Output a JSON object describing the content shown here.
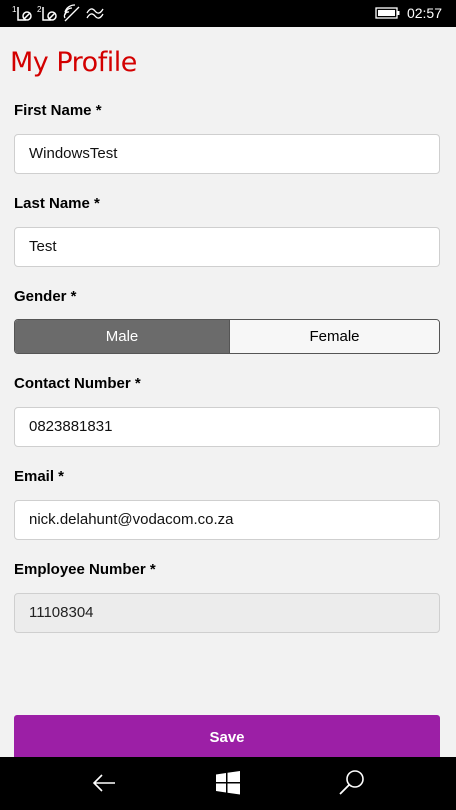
{
  "status_bar": {
    "time": "02:57",
    "sim1_label": "1",
    "sim2_label": "2"
  },
  "page": {
    "title": "My Profile"
  },
  "form": {
    "first_name": {
      "label": "First Name *",
      "value": "WindowsTest"
    },
    "last_name": {
      "label": "Last Name *",
      "value": "Test"
    },
    "gender": {
      "label": "Gender *",
      "options": [
        "Male",
        "Female"
      ],
      "selected": "Male"
    },
    "contact_number": {
      "label": "Contact Number *",
      "value": "0823881831"
    },
    "email": {
      "label": "Email *",
      "value": "nick.delahunt@vodacom.co.za"
    },
    "employee_number": {
      "label": "Employee Number *",
      "value": "11108304"
    }
  },
  "actions": {
    "save_label": "Save"
  },
  "nav": {
    "icons": [
      "back-arrow-icon",
      "windows-start-icon",
      "search-icon"
    ]
  },
  "colors": {
    "title_red": "#d30000",
    "save_purple": "#9c1fa6",
    "toggle_selected": "#6b6b6b"
  }
}
